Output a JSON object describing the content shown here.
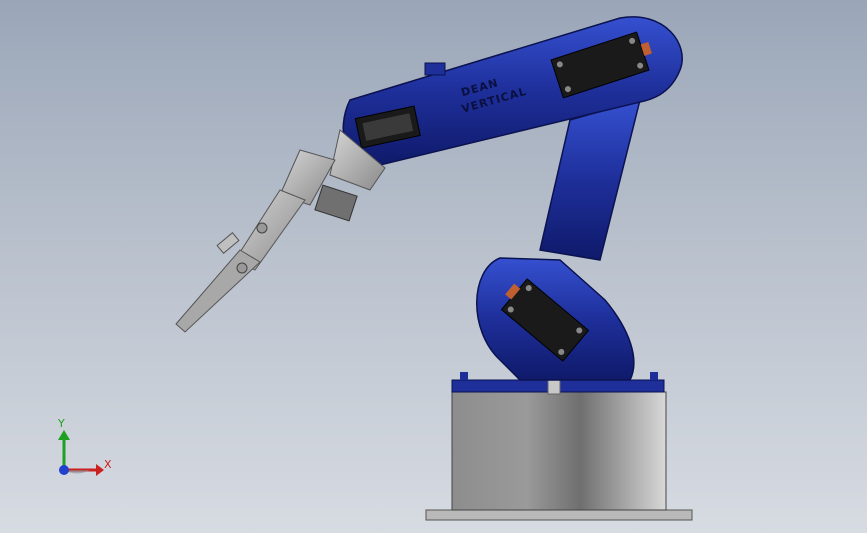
{
  "scene": {
    "model": "robot-arm-assembly",
    "arm_label_line1": "DEAN",
    "arm_label_line2": "VERTICAL",
    "body_color": "#1e2f9a",
    "base_color": "#a9a9a9",
    "gripper_color": "#b9b9b9",
    "servo_color": "#1a1a1a"
  },
  "triad": {
    "x_label": "X",
    "y_label": "Y",
    "x_color": "#cc2020",
    "y_color": "#20a020",
    "z_color": "#2040d0"
  }
}
